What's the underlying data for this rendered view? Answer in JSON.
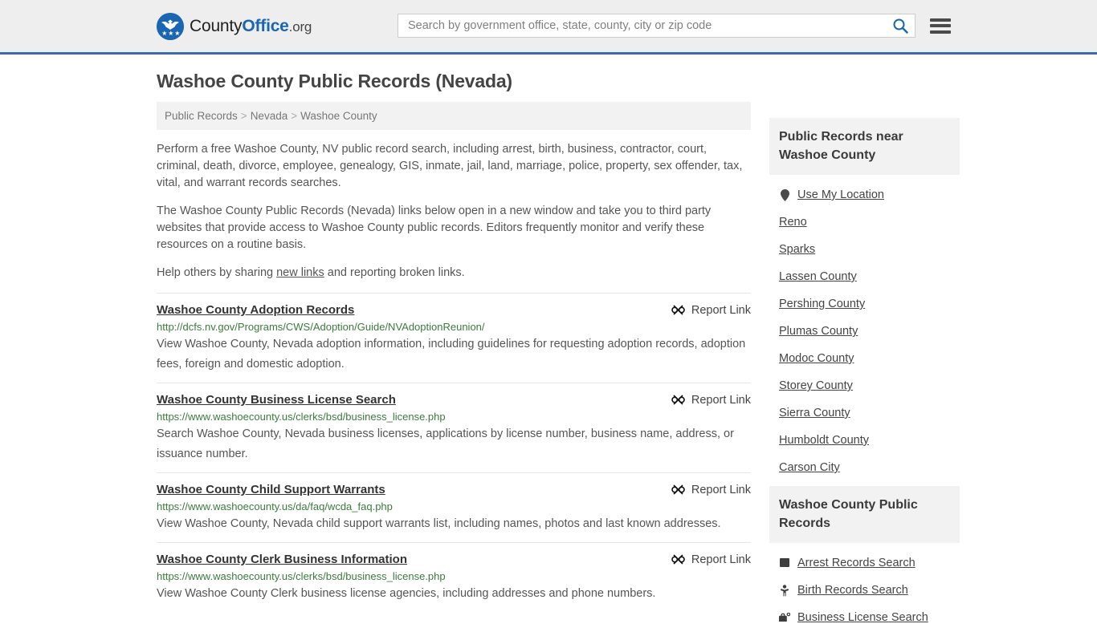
{
  "header": {
    "logo": {
      "part1": "County",
      "part2": "Office",
      "part3": ".org",
      "icon": "eagle-seal-icon"
    },
    "search": {
      "placeholder": "Search by government office, state, county, city or zip code",
      "value": "",
      "icon": "search-icon"
    },
    "menu_icon": "hamburger-menu-icon",
    "accent_color": "#3a6ea5"
  },
  "main": {
    "title": "Washoe County Public Records (Nevada)",
    "breadcrumb": [
      {
        "label": "Public Records"
      },
      {
        "label": "Nevada"
      },
      {
        "label": "Washoe County"
      }
    ],
    "breadcrumb_separator": ">",
    "intro_1": "Perform a free Washoe County, NV public record search, including arrest, birth, business, contractor, court, criminal, death, divorce, employee, genealogy, GIS, inmate, jail, land, marriage, police, property, sex offender, tax, vital, and warrant records searches.",
    "intro_2": "The Washoe County Public Records (Nevada) links below open in a new window and take you to third party websites that provide access to Washoe County public records. Editors frequently monitor and verify these resources on a routine basis.",
    "intro_3_before": "Help others by sharing ",
    "intro_3_link": "new links",
    "intro_3_after": " and reporting broken links.",
    "report_label": "Report Link",
    "report_icon": "broken-link-icon",
    "records": [
      {
        "title": "Washoe County Adoption Records",
        "url": "http://dcfs.nv.gov/Programs/CWS/Adoption/Guide/NVAdoptionReunion/",
        "description": "View Washoe County, Nevada adoption information, including guidelines for requesting adoption records, adoption fees, foreign and domestic adoption."
      },
      {
        "title": "Washoe County Business License Search",
        "url": "https://www.washoecounty.us/clerks/bsd/business_license.php",
        "description": "Search Washoe County, Nevada business licenses, applications by license number, business name, address, or issuance number."
      },
      {
        "title": "Washoe County Child Support Warrants",
        "url": "https://www.washoecounty.us/da/faq/wcda_faq.php",
        "description": "View Washoe County, Nevada child support warrants list, including names, photos and last known addresses."
      },
      {
        "title": "Washoe County Clerk Business Information",
        "url": "https://www.washoecounty.us/clerks/bsd/business_license.php",
        "description": "View Washoe County Clerk business license agencies, including addresses and phone numbers."
      }
    ]
  },
  "sidebar": {
    "nearby": {
      "heading": "Public Records near Washoe County",
      "items": [
        {
          "label": "Use My Location",
          "icon": "map-pin-icon"
        },
        {
          "label": "Reno",
          "icon": ""
        },
        {
          "label": "Sparks",
          "icon": ""
        },
        {
          "label": "Lassen County",
          "icon": ""
        },
        {
          "label": "Pershing County",
          "icon": ""
        },
        {
          "label": "Plumas County",
          "icon": ""
        },
        {
          "label": "Modoc County",
          "icon": ""
        },
        {
          "label": "Storey County",
          "icon": ""
        },
        {
          "label": "Sierra County",
          "icon": ""
        },
        {
          "label": "Humboldt County",
          "icon": ""
        },
        {
          "label": "Carson City",
          "icon": ""
        }
      ]
    },
    "records": {
      "heading": "Washoe County Public Records",
      "items": [
        {
          "label": "Arrest Records Search",
          "icon": "square-icon"
        },
        {
          "label": "Birth Records Search",
          "icon": "baby-icon"
        },
        {
          "label": "Business License Search",
          "icon": "briefcase-icon"
        }
      ]
    }
  }
}
